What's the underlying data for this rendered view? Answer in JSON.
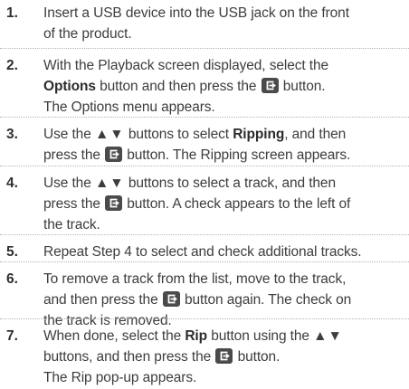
{
  "steps": [
    {
      "number": "1.",
      "lines": [
        [
          "Insert a USB device into the USB jack on the front"
        ],
        [
          "of the product."
        ]
      ]
    },
    {
      "number": "2.",
      "lines": [
        [
          "With the Playback screen displayed, select the"
        ],
        [
          "Options",
          " button and then press the ",
          "[enter-icon]",
          " button."
        ],
        [
          "The Options menu appears."
        ]
      ]
    },
    {
      "number": "3.",
      "lines": [
        [
          "Use the ",
          "▲▼",
          " buttons to select ",
          "Ripping",
          ", and then"
        ],
        [
          "press the ",
          "[enter-icon]",
          " button. The Ripping screen appears."
        ]
      ]
    },
    {
      "number": "4.",
      "lines": [
        [
          "Use the ",
          "▲▼",
          " buttons to select a track, and then"
        ],
        [
          "press the ",
          "[enter-icon]",
          " button. A check appears to the left of"
        ],
        [
          "the track."
        ]
      ]
    },
    {
      "number": "5.",
      "lines": [
        [
          "Repeat Step 4 to select and check additional tracks."
        ]
      ]
    },
    {
      "number": "6.",
      "lines": [
        [
          "To remove a track from the list, move to the track,"
        ],
        [
          "and then press the ",
          "[enter-icon]",
          " button again. The check on"
        ],
        [
          "the track is removed."
        ]
      ]
    },
    {
      "number": "7.",
      "lines": [
        [
          "When done, select the ",
          "Rip",
          " button using the ",
          "▲▼"
        ],
        [
          "buttons, and then press the ",
          "[enter-icon]",
          " button."
        ],
        [
          "The Rip pop-up appears."
        ]
      ]
    }
  ],
  "icons": {
    "enter": "enter-button-icon"
  },
  "colors": {
    "text": "#3d3d3d",
    "icon_bg": "#4a4a4a",
    "rule": "#b5b5b5"
  }
}
